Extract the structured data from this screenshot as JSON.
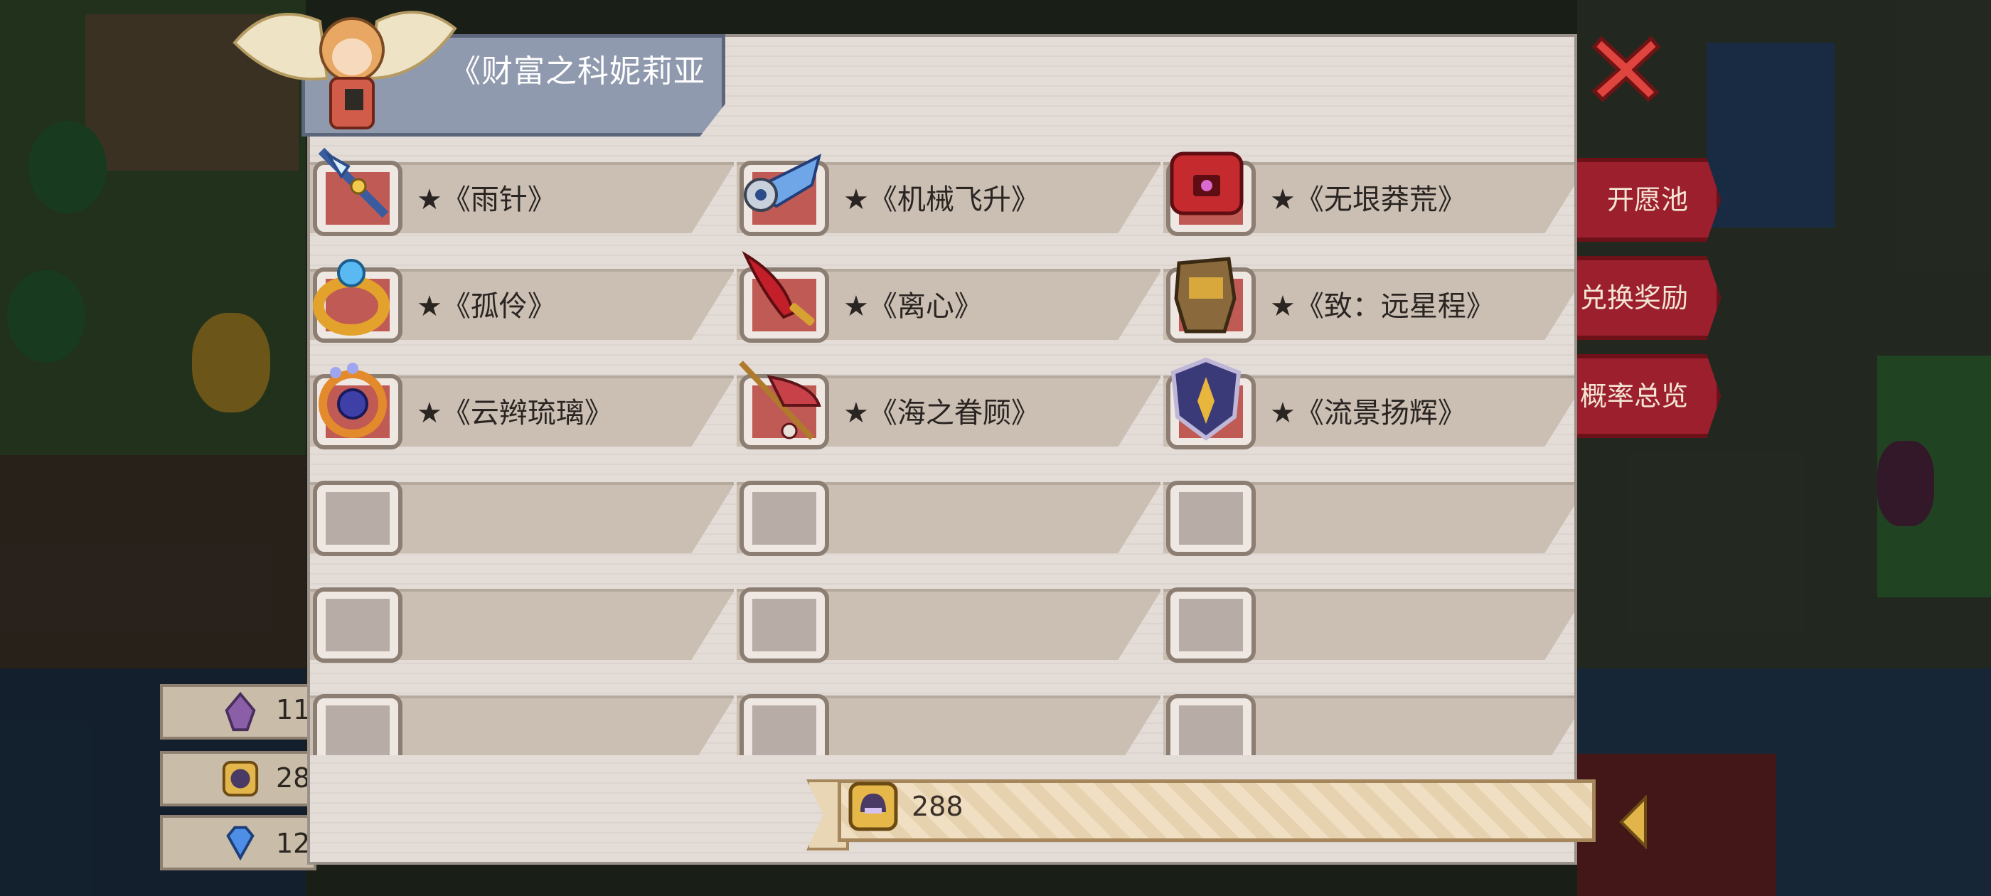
{
  "dialog": {
    "title": "《财富之科妮莉亚",
    "close_icon": "close-icon",
    "items": [
      {
        "label": "★《雨针》",
        "icon": "spear-icon"
      },
      {
        "label": "★《机械飞升》",
        "icon": "mech-wing-icon"
      },
      {
        "label": "★《无垠莽荒》",
        "icon": "red-belt-icon"
      },
      {
        "label": "★《孤伶》",
        "icon": "gold-ring-icon"
      },
      {
        "label": "★《离心》",
        "icon": "red-dagger-icon"
      },
      {
        "label": "★《致：远星程》",
        "icon": "gauntlet-icon"
      },
      {
        "label": "★《云辫琉璃》",
        "icon": "gem-circlet-icon"
      },
      {
        "label": "★《海之眷顾》",
        "icon": "fishing-rod-icon"
      },
      {
        "label": "★《流景扬辉》",
        "icon": "shield-emblem-icon"
      }
    ],
    "empty_slots": 9,
    "cost": {
      "icon": "helmet-token-icon",
      "value": "288"
    }
  },
  "side_menu": [
    {
      "label": "开愿池"
    },
    {
      "label": "兑换奖励"
    },
    {
      "label": "概率总览"
    }
  ],
  "currencies": [
    {
      "icon": "purple-crystal-icon",
      "value": "11"
    },
    {
      "icon": "helmet-token-icon",
      "value": "28"
    },
    {
      "icon": "blue-diamond-icon",
      "value": "12"
    }
  ],
  "colors": {
    "panel_bg": "#e3dcd7",
    "title_tab": "#909aae",
    "side_button": "#9b1f2c",
    "close": "#e0443f",
    "cost_banner": "#f0dfc2"
  }
}
